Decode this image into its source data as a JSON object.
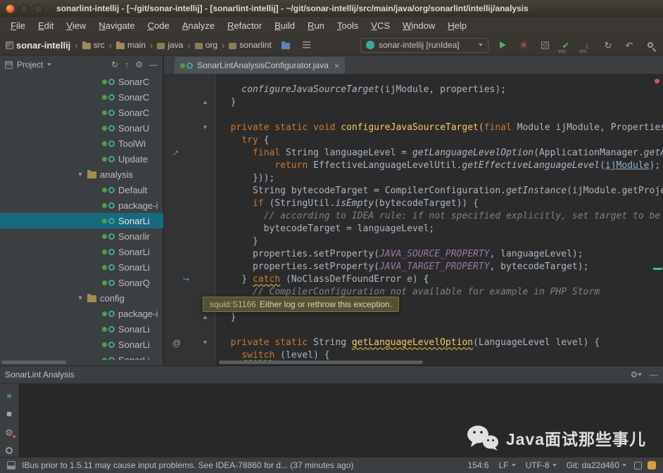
{
  "window": {
    "title": "sonarlint-intellij - [~/git/sonar-intellij] - [sonarlint-intellij] - ~/git/sonar-intellij/src/main/java/org/sonarlint/intellij/analysis"
  },
  "menu": {
    "items": [
      "File",
      "Edit",
      "View",
      "Navigate",
      "Code",
      "Analyze",
      "Refactor",
      "Build",
      "Run",
      "Tools",
      "VCS",
      "Window",
      "Help"
    ]
  },
  "toolbar": {
    "breadcrumbs": [
      {
        "label": "sonar-intellij",
        "icon": "project"
      },
      {
        "label": "src",
        "icon": "folder"
      },
      {
        "label": "main",
        "icon": "folder"
      },
      {
        "label": "java",
        "icon": "package"
      },
      {
        "label": "org",
        "icon": "package"
      },
      {
        "label": "sonarlint",
        "icon": "package"
      }
    ],
    "run_config": "sonar-intellij [runIdea]"
  },
  "project_panel": {
    "title": "Project",
    "tree": [
      {
        "label": "SonarC",
        "type": "class",
        "depth": 7
      },
      {
        "label": "SonarC",
        "type": "class",
        "depth": 7
      },
      {
        "label": "SonarC",
        "type": "class",
        "depth": 7
      },
      {
        "label": "SonarU",
        "type": "class",
        "depth": 7
      },
      {
        "label": "ToolWi",
        "type": "class",
        "depth": 7
      },
      {
        "label": "Update",
        "type": "class",
        "depth": 7
      },
      {
        "label": "analysis",
        "type": "folder",
        "depth": 5,
        "expanded": true
      },
      {
        "label": "Default",
        "type": "class",
        "depth": 7
      },
      {
        "label": "package-i",
        "type": "class",
        "depth": 7
      },
      {
        "label": "SonarLi",
        "type": "class",
        "depth": 7,
        "selected": true
      },
      {
        "label": "Sonarlir",
        "type": "class",
        "depth": 7
      },
      {
        "label": "SonarLi",
        "type": "class",
        "depth": 7
      },
      {
        "label": "SonarLi",
        "type": "class",
        "depth": 7
      },
      {
        "label": "SonarQ",
        "type": "class",
        "depth": 7
      },
      {
        "label": "config",
        "type": "folder",
        "depth": 5,
        "expanded": true
      },
      {
        "label": "package-i",
        "type": "class",
        "depth": 7
      },
      {
        "label": "SonarLi",
        "type": "class",
        "depth": 7
      },
      {
        "label": "SonarLi",
        "type": "class",
        "depth": 7
      },
      {
        "label": "SonarLi",
        "type": "class",
        "depth": 7
      }
    ]
  },
  "editor": {
    "tab_title": "SonarLintAnalysisConfigurator.java",
    "lines": [
      [
        {
          "c": "i",
          "t": "    configureJavaSourceTarget"
        },
        {
          "c": "d",
          "t": "(ijModule, properties);"
        }
      ],
      [
        {
          "c": "d",
          "t": "  }"
        }
      ],
      [],
      [
        {
          "c": "k",
          "t": "  private static void "
        },
        {
          "c": "m",
          "t": "configureJavaSourceTarget"
        },
        {
          "c": "d",
          "t": "("
        },
        {
          "c": "k",
          "t": "final "
        },
        {
          "c": "d",
          "t": "Module ijModule, Properties"
        }
      ],
      [
        {
          "c": "k",
          "t": "    try "
        },
        {
          "c": "d",
          "t": "{"
        }
      ],
      [
        {
          "c": "k",
          "t": "      final "
        },
        {
          "c": "d",
          "t": "String languageLevel = "
        },
        {
          "c": "i",
          "t": "getLanguageLevelOption"
        },
        {
          "c": "d",
          "t": "(ApplicationManager."
        },
        {
          "c": "i",
          "t": "getA"
        }
      ],
      [
        {
          "c": "k",
          "t": "          return "
        },
        {
          "c": "d",
          "t": "EffectiveLanguageLevelUtil."
        },
        {
          "c": "i",
          "t": "getEffectiveLanguageLevel"
        },
        {
          "c": "d",
          "t": "("
        },
        {
          "c": "u",
          "t": "ijModule"
        },
        {
          "c": "d",
          "t": ");"
        }
      ],
      [
        {
          "c": "d",
          "t": "      }));"
        }
      ],
      [
        {
          "c": "d",
          "t": "      String bytecodeTarget = CompilerConfiguration."
        },
        {
          "c": "i",
          "t": "getInstance"
        },
        {
          "c": "d",
          "t": "(ijModule.getProje"
        }
      ],
      [
        {
          "c": "k",
          "t": "      if "
        },
        {
          "c": "d",
          "t": "(StringUtil."
        },
        {
          "c": "i",
          "t": "isEmpty"
        },
        {
          "c": "d",
          "t": "(bytecodeTarget)) {"
        }
      ],
      [
        {
          "c": "c",
          "t": "        // according to IDEA rule: if not specified explicitly, set target to be"
        }
      ],
      [
        {
          "c": "d",
          "t": "        bytecodeTarget = languageLevel;"
        }
      ],
      [
        {
          "c": "d",
          "t": "      }"
        }
      ],
      [
        {
          "c": "d",
          "t": "      properties.setProperty("
        },
        {
          "c": "p",
          "t": "JAVA_SOURCE_PROPERTY"
        },
        {
          "c": "d",
          "t": ", languageLevel);"
        }
      ],
      [
        {
          "c": "d",
          "t": "      properties.setProperty("
        },
        {
          "c": "p",
          "t": "JAVA_TARGET_PROPERTY"
        },
        {
          "c": "d",
          "t": ", bytecodeTarget);"
        }
      ],
      [
        {
          "c": "d",
          "t": "    } "
        },
        {
          "c": "k w",
          "t": "catch"
        },
        {
          "c": "d",
          "t": " (NoClassDefFoundError e) "
        },
        {
          "c": "b",
          "t": "{"
        }
      ],
      [
        {
          "c": "c",
          "t": "      // CompilerConfiguration not available for example in PHP Storm"
        }
      ],
      [
        {
          "c": "d",
          "t": "    }"
        }
      ],
      [
        {
          "c": "d",
          "t": "  }"
        }
      ],
      [],
      [
        {
          "c": "k",
          "t": "  private static "
        },
        {
          "c": "d",
          "t": "String "
        },
        {
          "c": "m w",
          "t": "getLanguageLevelOption"
        },
        {
          "c": "d",
          "t": "(LanguageLevel level) {"
        }
      ],
      [
        {
          "c": "d",
          "t": "    "
        },
        {
          "c": "k w",
          "t": "switch"
        },
        {
          "c": "d",
          "t": " (level) {"
        }
      ]
    ],
    "gutter_marks": [
      {
        "line": 1,
        "type": "fold_up"
      },
      {
        "line": 3,
        "type": "fold_down"
      },
      {
        "line": 5,
        "type": "impl"
      },
      {
        "line": 15,
        "type": "sonar"
      },
      {
        "line": 18,
        "type": "fold_up"
      },
      {
        "line": 20,
        "type": "fold_down"
      },
      {
        "line": 20,
        "type": "at"
      }
    ]
  },
  "tooltip": {
    "rule": "squid:S1166",
    "message": "Either log or rethrow this exception."
  },
  "bottom_panel": {
    "title": "SonarLint Analysis"
  },
  "watermark": {
    "text": "Java面试那些事儿"
  },
  "status_bar": {
    "message": "IBus prior to 1.5.11 may cause input problems. See IDEA-78860 for d... (37 minutes ago)",
    "caret_position": "154:6",
    "line_separator": "LF",
    "encoding": "UTF-8",
    "vcs": "Git: da22d460"
  },
  "colors": {
    "selection_teal": "#17697f",
    "keyword_orange": "#cc7832",
    "method_yellow": "#ffc66b",
    "constant_purple": "#9876aa",
    "comment_gray": "#808080",
    "editor_bg": "#2b2b2b",
    "panel_bg": "#3c3f41",
    "tooltip_olive": "#545233",
    "error_red": "#d25252",
    "run_green": "#53ad5d",
    "close_orange": "#e4571f"
  },
  "icons": {
    "chevron": "›",
    "fold_up": "▴",
    "fold_down": "▾",
    "close": "×",
    "gear": "⚙",
    "check": "✔",
    "arrow_down": "↓",
    "rollback": "↶",
    "sync": "↻",
    "burst": "✳",
    "impl": "↗",
    "sonar": "↪",
    "at": "@",
    "double_chevron": "»",
    "stop": "■",
    "minimize": "—",
    "collapse": "↑",
    "vcs_label": "vcs"
  }
}
